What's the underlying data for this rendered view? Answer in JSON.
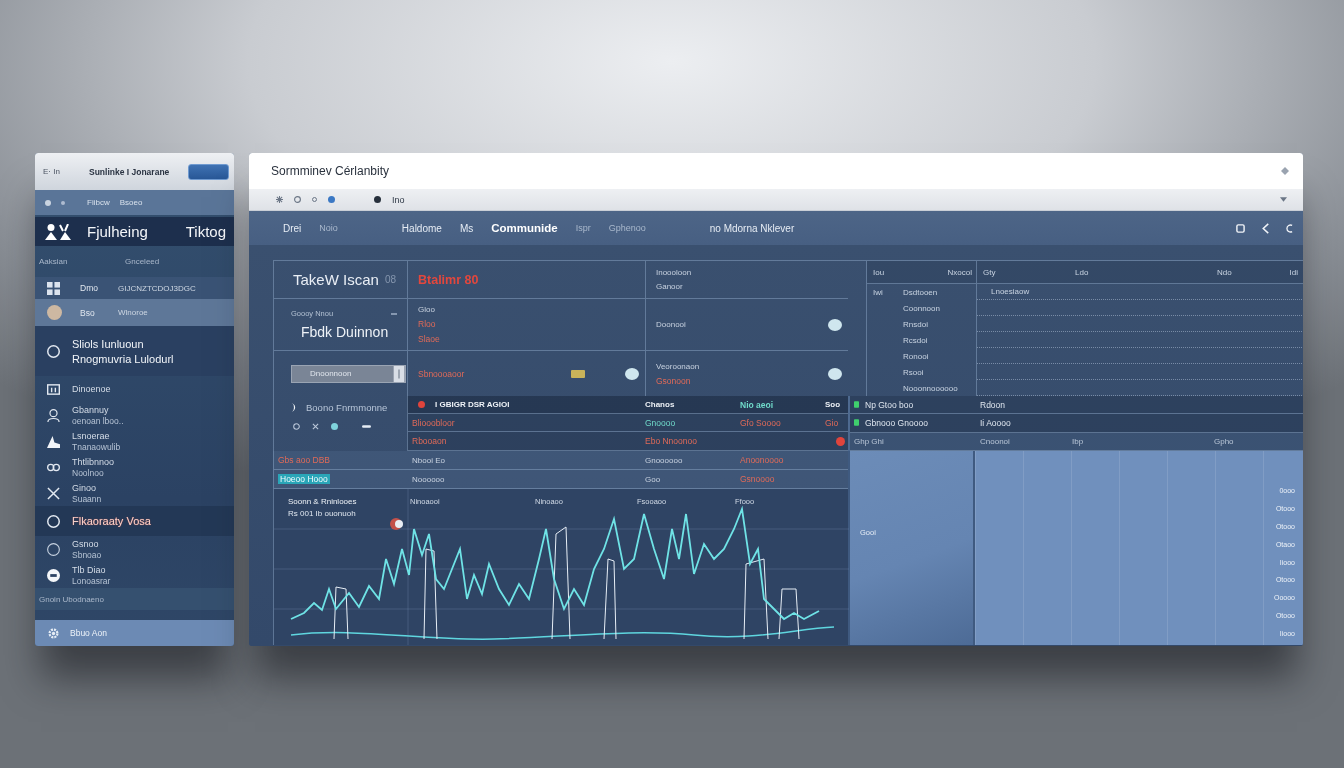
{
  "sidebar": {
    "top_bar": {
      "label": "E· In",
      "title": "Sunlinke I Jonarane"
    },
    "sub_bar": [
      "Fiibcw",
      "Bsoeo"
    ],
    "header": {
      "title": "Fjulheing",
      "tag": "Tiktog"
    },
    "columns": [
      "Aaksian",
      "Gnceleed"
    ],
    "items": [
      {
        "kind": "pair",
        "title": "Dmo",
        "value": "GIJCNZTCDOJ3DGC",
        "selected": false,
        "flagged": false
      },
      {
        "kind": "pair",
        "title": "Bso",
        "value": "Wlnoroe",
        "selected": true,
        "flagged": false
      },
      {
        "kind": "feature",
        "title": "Sliols Iunluoun",
        "subtitle": "Rnogmuvria Lulodurl",
        "selected": false,
        "flagged": false
      },
      {
        "kind": "stack",
        "title": "Dinoenoe",
        "selected": false,
        "flagged": false
      },
      {
        "kind": "stack",
        "title": "Gbannuy",
        "subtitle": "oenoan lboo..",
        "selected": false,
        "flagged": false
      },
      {
        "kind": "stack",
        "title": "Lsnoerae",
        "subtitle": "Tnanaowulib",
        "selected": false,
        "flagged": false
      },
      {
        "kind": "stack",
        "title": "Thtlibnnoo",
        "subtitle": "Noolnoo",
        "selected": false,
        "flagged": false
      },
      {
        "kind": "stack",
        "title": "Ginoo",
        "subtitle": "Suaann",
        "selected": false,
        "flagged": false
      },
      {
        "kind": "stack",
        "title": "Flkaoraaty Vosa",
        "selected": false,
        "flagged": true
      },
      {
        "kind": "stack",
        "title": "Gsnoo",
        "subtitle": "Sbnoao",
        "selected": false,
        "flagged": false
      },
      {
        "kind": "stack",
        "title": "Tlb Diao",
        "subtitle": "Lonoasrar",
        "selected": false,
        "flagged": false
      }
    ],
    "note": "Gnoin Ubodnaeno",
    "footer": "Bbuo Aon"
  },
  "window": {
    "title": "Sormminev Cérlanbity"
  },
  "toolbar": {
    "label": "Ino"
  },
  "nav": {
    "groups": [
      {
        "items": [
          {
            "label": "Drei",
            "selected": false,
            "disabled": false
          },
          {
            "label": "Noio",
            "selected": false,
            "disabled": true
          }
        ]
      },
      {
        "items": [
          {
            "label": "Haldome",
            "selected": false,
            "disabled": false
          },
          {
            "label": "Ms",
            "selected": false,
            "disabled": false
          },
          {
            "label": "Communide",
            "selected": true,
            "disabled": false
          },
          {
            "label": "Ispr",
            "selected": false,
            "disabled": true
          },
          {
            "label": "Gphenoo",
            "selected": false,
            "disabled": true
          }
        ]
      },
      {
        "items": [
          {
            "label": "no Mdorna Nklever",
            "selected": false,
            "disabled": false
          }
        ]
      }
    ]
  },
  "overview": {
    "title": "TakeW Iscan",
    "title_suffix": "08",
    "caption": "Goooy Nnou",
    "heading": "Fbdk Duinnon",
    "field_value": "Dnoonnoon",
    "link": "Boono Fnrmmonne"
  },
  "panel": {
    "blocks": [
      {
        "texts": [
          {
            "text": "Btalimr 80",
            "kind": "headline"
          }
        ],
        "chip": false,
        "dot": false
      },
      {
        "texts": [
          {
            "text": "Inoooloon",
            "kind": "label"
          },
          {
            "text": "Ganoor",
            "kind": "label"
          }
        ],
        "chip": false,
        "dot": false
      },
      {
        "texts": [
          {
            "text": "Gloo",
            "kind": "label"
          },
          {
            "text": "Rloo",
            "kind": "alert"
          },
          {
            "text": "Slaoe",
            "kind": "alert"
          }
        ],
        "chip": false,
        "dot": false
      },
      {
        "texts": [
          {
            "text": "Doonooi",
            "kind": "label"
          }
        ],
        "chip": false,
        "dot": true
      },
      {
        "texts": [
          {
            "text": "Sbnoooaoor",
            "kind": "alert"
          }
        ],
        "chip": true,
        "dot": true
      },
      {
        "texts": [
          {
            "text": "Veoroonaon",
            "kind": "label"
          },
          {
            "text": "Gsonoon",
            "kind": "alert"
          }
        ],
        "chip": false,
        "dot": true
      }
    ]
  },
  "table": {
    "rows": [
      {
        "kind": "header",
        "alert": false,
        "cells": [
          {
            "text": "I GBIGR DSR AGIOI",
            "kind": "label"
          },
          {
            "text": "Chanos",
            "kind": "label"
          },
          {
            "text": "Nio aeoi",
            "kind": "accent"
          },
          {
            "text": "Soo",
            "kind": "label"
          }
        ]
      },
      {
        "kind": "data",
        "alert": false,
        "cells": [
          {
            "text": "Bliooobloor",
            "kind": "alert"
          },
          {
            "text": "Gnoooo",
            "kind": "accent"
          },
          {
            "text": "Gfo Soooo",
            "kind": "alert"
          },
          {
            "text": "Gio",
            "kind": "alert"
          }
        ]
      },
      {
        "kind": "data",
        "alert": true,
        "cells": [
          {
            "text": "Rbooaon",
            "kind": "alert"
          },
          {
            "text": "Ebo Nnoonoo",
            "kind": "alert"
          }
        ]
      },
      {
        "kind": "data",
        "alert": false,
        "lead": {
          "text": "Gbs aoo DBB",
          "kind": "alert"
        },
        "cells": [
          {
            "text": "Nbooi Eo",
            "kind": "label"
          },
          {
            "text": "Gnoooooo",
            "kind": "label"
          },
          {
            "text": "Anoonoooo",
            "kind": "alert"
          }
        ]
      },
      {
        "kind": "data",
        "alert": false,
        "lead": {
          "text": "Hoeoo Hooo",
          "kind": "accent"
        },
        "cells": [
          {
            "text": "Noooooo",
            "kind": "label"
          },
          {
            "text": "Goo",
            "kind": "label"
          },
          {
            "text": "Gsnoooo",
            "kind": "alert"
          }
        ]
      }
    ]
  },
  "grid_table": {
    "columns": [
      "Iou",
      "Nxocol",
      "Gty",
      "Ldo",
      "Ndo",
      "Idi"
    ],
    "rows": [
      {
        "tag": "Iwi",
        "name": "Dsdtooen",
        "note": "Lnoesiaow"
      },
      {
        "name": "Coonnoon"
      },
      {
        "name": "Rnsdoi"
      },
      {
        "name": "Rcsdoi"
      },
      {
        "name": "Ronooi"
      },
      {
        "name": "Rsooi"
      },
      {
        "name": "Nooonnoooooo"
      }
    ]
  },
  "mini_table": {
    "rows": [
      {
        "online": true,
        "cells": [
          "Np Gtoo boo",
          "Rdoon"
        ]
      },
      {
        "online": true,
        "cells": [
          "Gbnooo Gnoooo",
          "Ii Aoooo"
        ]
      },
      {
        "online": false,
        "cells": [
          "Ghp Ghi",
          "Cnoonoi",
          "Ibp",
          "Gpho"
        ]
      }
    ]
  },
  "chart": {
    "title": "Soonn & Rninlooes",
    "subtitle": "Rs 001 Ib ouonuoh",
    "labels": [
      "Ninoaooi",
      "Ninoaoo",
      "Fsooaoo",
      "Ffooo"
    ]
  },
  "side_panel": {
    "label": "Gooi"
  },
  "scale_panel": {
    "labels": [
      "0ooo",
      "Otooo",
      "Otooo",
      "Otaoo",
      "Iiooo",
      "Otooo",
      "Ooooo",
      "Otooo",
      "Iiooo"
    ]
  }
}
